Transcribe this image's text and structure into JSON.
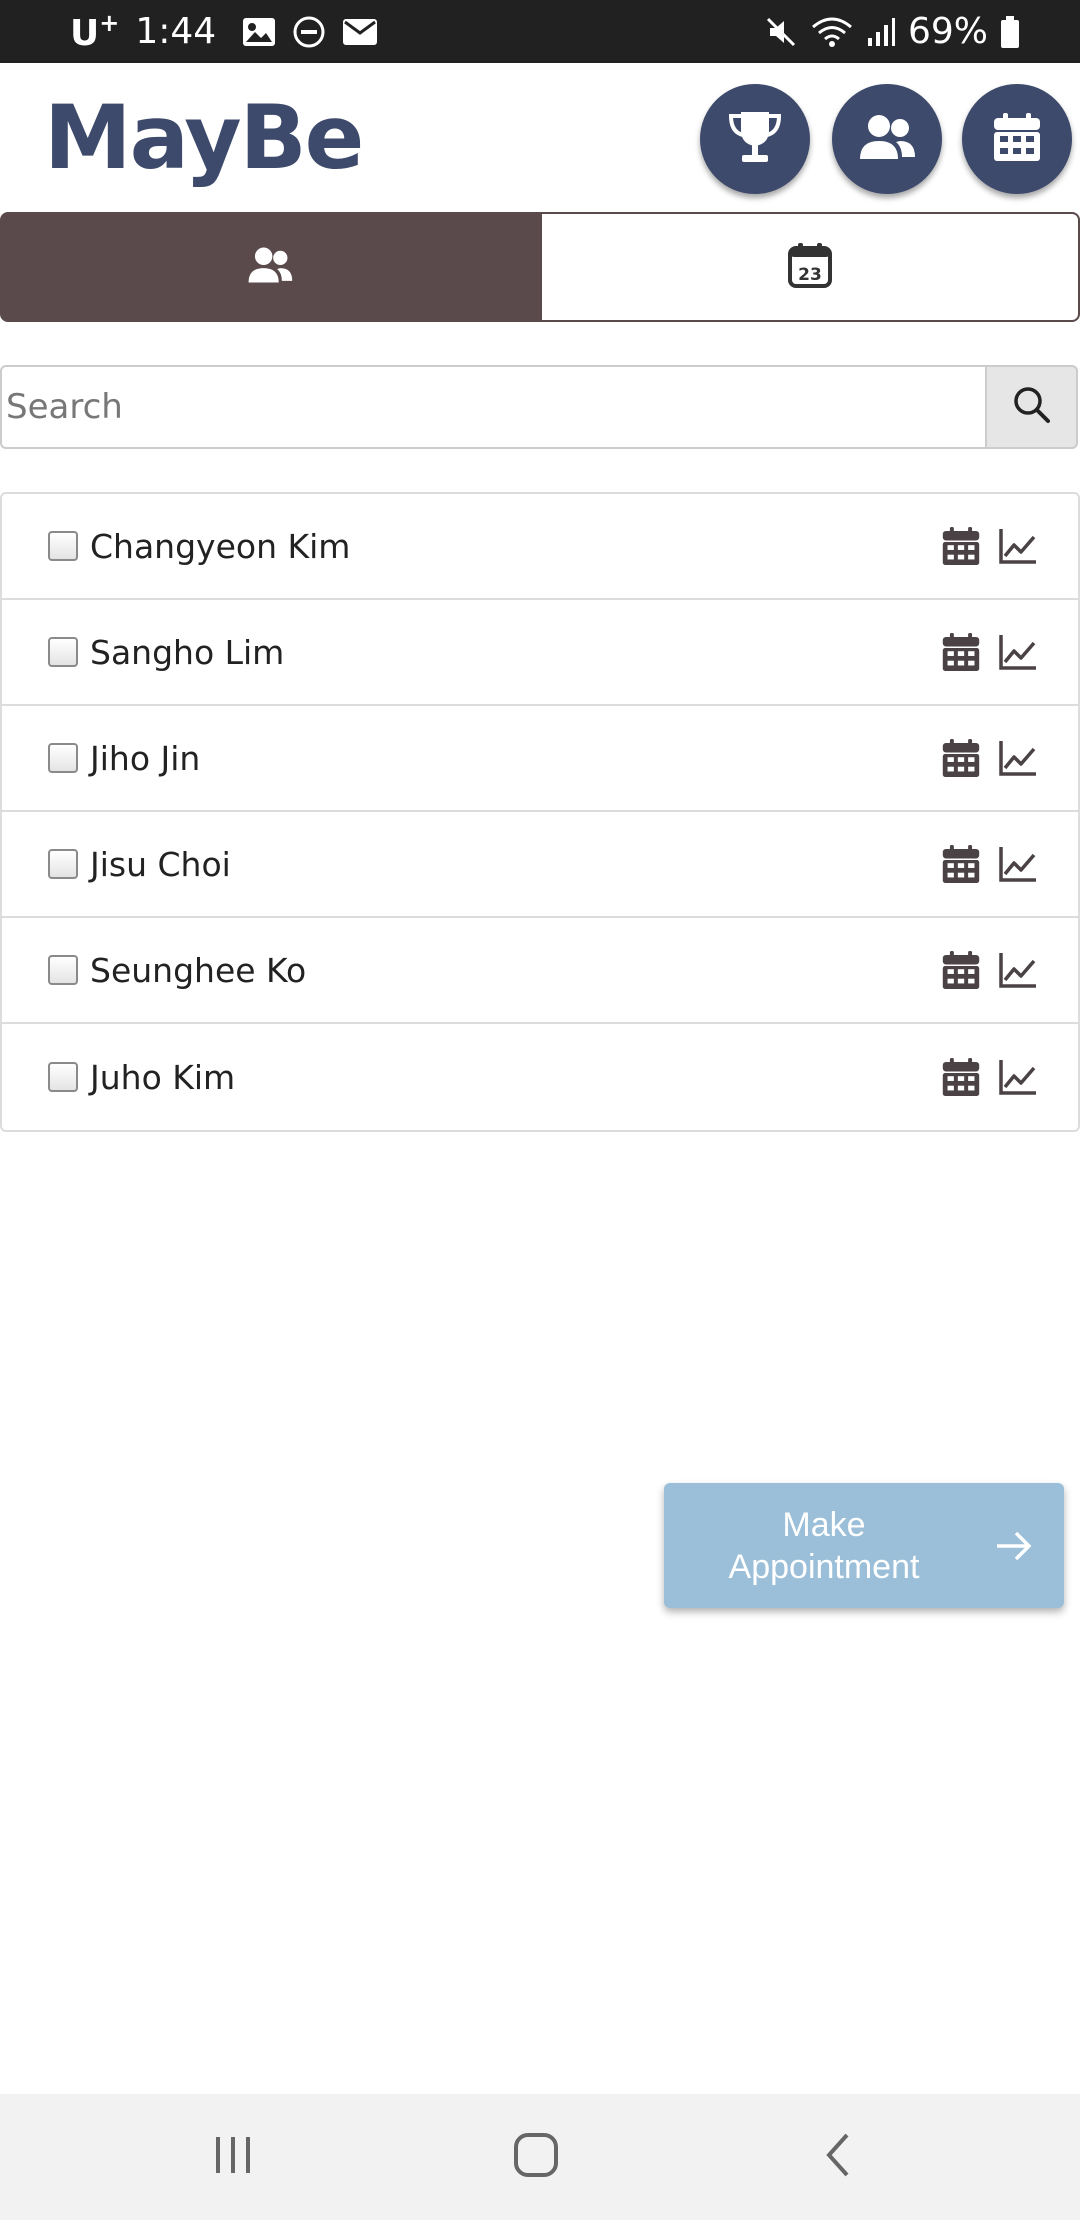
{
  "status_bar": {
    "carrier": "U",
    "carrier_sup": "+",
    "time": "1:44",
    "battery": "69%"
  },
  "header": {
    "title": "MayBe",
    "buttons": [
      {
        "icon": "trophy-icon"
      },
      {
        "icon": "friends-icon"
      },
      {
        "icon": "calendar-icon"
      }
    ]
  },
  "tabs": [
    {
      "icon": "friends-icon",
      "active": true
    },
    {
      "icon": "calendar-date-icon",
      "badge": "23",
      "active": false
    }
  ],
  "search": {
    "placeholder": "Search",
    "value": ""
  },
  "friends": [
    {
      "name": "Changyeon Kim",
      "checked": false
    },
    {
      "name": "Sangho Lim",
      "checked": false
    },
    {
      "name": "Jiho Jin",
      "checked": false
    },
    {
      "name": "Jisu Choi",
      "checked": false
    },
    {
      "name": "Seunghee Ko",
      "checked": false
    },
    {
      "name": "Juho Kim",
      "checked": false
    }
  ],
  "make_appointment": {
    "line1": "Make",
    "line2": "Appointment"
  },
  "colors": {
    "brand": "#3d4a6b",
    "tab_active": "#5a4a4c",
    "action_button": "#9bbfd8",
    "status_bar": "#212121"
  }
}
